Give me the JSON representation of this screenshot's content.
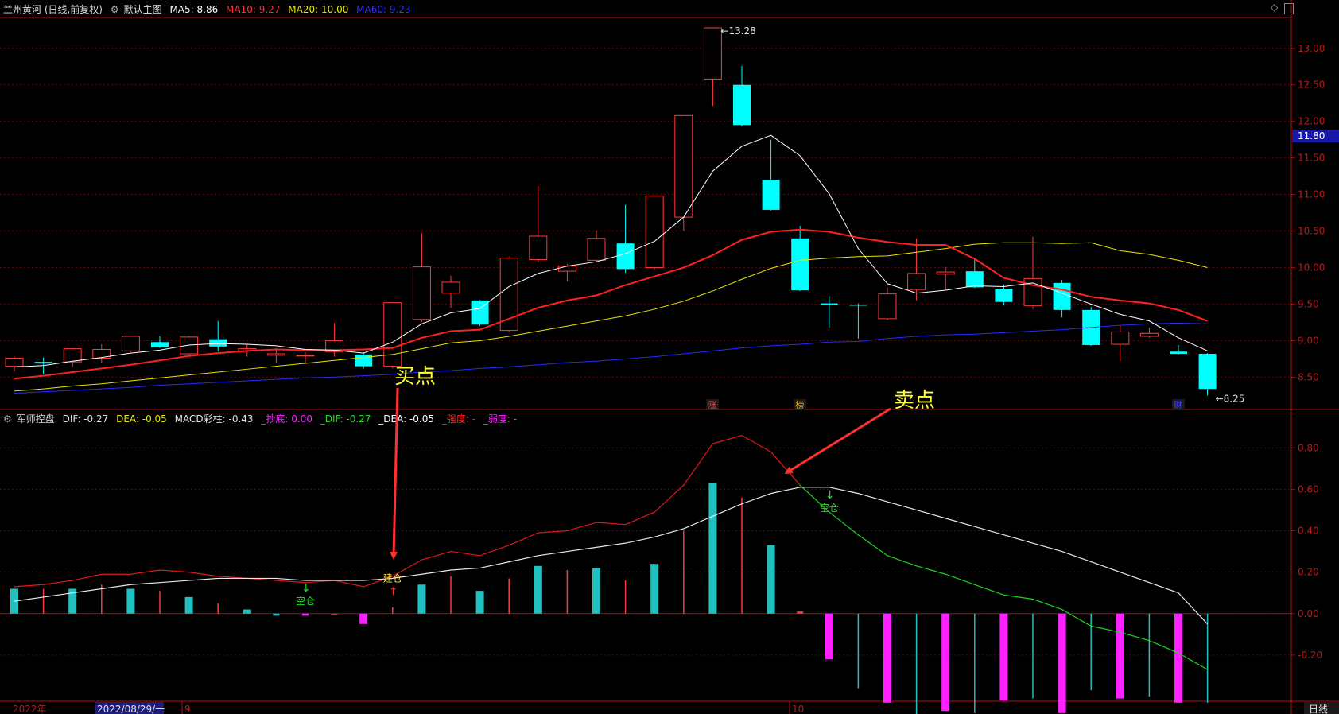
{
  "header": {
    "stock": "兰州黄河 (日线,前复权)",
    "main_label": "默认主图",
    "ma5": "MA5: 8.86",
    "ma10": "MA10: 9.27",
    "ma20": "MA20: 10.00",
    "ma60": "MA60: 9.23"
  },
  "sub_header": {
    "name": "军师控盘",
    "dif": "DIF: -0.27",
    "dea": "DEA: -0.05",
    "macd": "MACD彩柱: -0.43",
    "chaodi": "_抄底: 0.00",
    "sdif": "_DIF: -0.27",
    "sdea": "_DEA: -0.05",
    "qiangdu": "_强度: -",
    "ruodu": "_弱度: -"
  },
  "bottom": {
    "year": "2022年",
    "date": "2022/08/29/一",
    "m9": "9",
    "m10": "10",
    "period": "日线"
  },
  "annotations": {
    "buy": "买点",
    "sell": "卖点",
    "jiancang": "建仓",
    "kongcang": "空仓",
    "zhang": "涨",
    "bang": "榜",
    "cai": "财"
  },
  "price_marks": {
    "high": "13.28",
    "low": "8.25",
    "current": "11.80"
  },
  "colors": {
    "up": "#ff3b3b",
    "down": "#00ffff",
    "ma5": "#ffffff",
    "ma10": "#ff2020",
    "ma20": "#e6e600",
    "ma60": "#2a2aff",
    "grid": "#5a0a0a",
    "axis": "#b01010",
    "annotation": "#ffff33",
    "arrow": "#ff3030",
    "hist_pos": "#20c0c0",
    "hist_neg": "#ff20ff"
  },
  "chart_data": [
    {
      "type": "candlestick",
      "ylim": [
        8.2,
        13.4
      ],
      "yticks": [
        8.5,
        9.0,
        9.5,
        10.0,
        10.5,
        11.0,
        11.5,
        12.0,
        12.5,
        13.0
      ],
      "candles": [
        {
          "o": 8.65,
          "h": 8.78,
          "l": 8.58,
          "c": 8.76
        },
        {
          "o": 8.71,
          "h": 8.77,
          "l": 8.54,
          "c": 8.69
        },
        {
          "o": 8.71,
          "h": 8.9,
          "l": 8.64,
          "c": 8.89
        },
        {
          "o": 8.76,
          "h": 8.95,
          "l": 8.7,
          "c": 8.88
        },
        {
          "o": 8.86,
          "h": 9.06,
          "l": 8.84,
          "c": 9.06
        },
        {
          "o": 8.98,
          "h": 9.06,
          "l": 8.9,
          "c": 8.91
        },
        {
          "o": 8.82,
          "h": 9.06,
          "l": 8.81,
          "c": 9.05
        },
        {
          "o": 9.02,
          "h": 9.27,
          "l": 8.85,
          "c": 8.92
        },
        {
          "o": 8.86,
          "h": 8.95,
          "l": 8.78,
          "c": 8.89
        },
        {
          "o": 8.8,
          "h": 8.9,
          "l": 8.7,
          "c": 8.82
        },
        {
          "o": 8.8,
          "h": 8.84,
          "l": 8.7,
          "c": 8.8
        },
        {
          "o": 8.85,
          "h": 9.24,
          "l": 8.78,
          "c": 9.0
        },
        {
          "o": 8.81,
          "h": 8.84,
          "l": 8.62,
          "c": 8.65
        },
        {
          "o": 8.65,
          "h": 9.52,
          "l": 8.62,
          "c": 9.52
        },
        {
          "o": 9.29,
          "h": 10.47,
          "l": 9.26,
          "c": 10.01
        },
        {
          "o": 9.65,
          "h": 9.89,
          "l": 9.45,
          "c": 9.8
        },
        {
          "o": 9.55,
          "h": 9.56,
          "l": 9.2,
          "c": 9.22
        },
        {
          "o": 9.14,
          "h": 10.15,
          "l": 9.12,
          "c": 10.13
        },
        {
          "o": 10.11,
          "h": 11.12,
          "l": 10.07,
          "c": 10.43
        },
        {
          "o": 9.95,
          "h": 10.05,
          "l": 9.81,
          "c": 10.02
        },
        {
          "o": 10.1,
          "h": 10.51,
          "l": 10.07,
          "c": 10.4
        },
        {
          "o": 10.33,
          "h": 10.86,
          "l": 9.93,
          "c": 9.98
        },
        {
          "o": 10.0,
          "h": 10.99,
          "l": 9.98,
          "c": 10.98
        },
        {
          "o": 10.69,
          "h": 12.08,
          "l": 10.5,
          "c": 12.08
        },
        {
          "o": 12.58,
          "h": 13.28,
          "l": 12.21,
          "c": 13.28
        },
        {
          "o": 12.5,
          "h": 12.76,
          "l": 11.93,
          "c": 11.95
        },
        {
          "o": 11.2,
          "h": 11.75,
          "l": 10.78,
          "c": 10.79
        },
        {
          "o": 10.4,
          "h": 10.57,
          "l": 9.68,
          "c": 9.69
        },
        {
          "o": 9.51,
          "h": 9.61,
          "l": 9.18,
          "c": 9.49
        },
        {
          "o": 9.49,
          "h": 9.51,
          "l": 9.03,
          "c": 9.48
        },
        {
          "o": 9.3,
          "h": 9.73,
          "l": 9.28,
          "c": 9.64
        },
        {
          "o": 9.7,
          "h": 10.4,
          "l": 9.55,
          "c": 9.92
        },
        {
          "o": 9.91,
          "h": 10.01,
          "l": 9.7,
          "c": 9.94
        },
        {
          "o": 9.95,
          "h": 10.13,
          "l": 9.72,
          "c": 9.73
        },
        {
          "o": 9.71,
          "h": 9.77,
          "l": 9.48,
          "c": 9.53
        },
        {
          "o": 9.48,
          "h": 10.42,
          "l": 9.43,
          "c": 9.85
        },
        {
          "o": 9.79,
          "h": 9.83,
          "l": 9.32,
          "c": 9.42
        },
        {
          "o": 9.42,
          "h": 9.46,
          "l": 8.93,
          "c": 8.94
        },
        {
          "o": 8.95,
          "h": 9.21,
          "l": 8.72,
          "c": 9.12
        },
        {
          "o": 9.06,
          "h": 9.18,
          "l": 9.04,
          "c": 9.1
        },
        {
          "o": 8.85,
          "h": 8.94,
          "l": 8.81,
          "c": 8.82
        },
        {
          "o": 8.82,
          "h": 8.83,
          "l": 8.25,
          "c": 8.34
        }
      ],
      "ma5": [
        8.64,
        8.66,
        8.72,
        8.77,
        8.83,
        8.87,
        8.94,
        8.96,
        8.95,
        8.93,
        8.88,
        8.87,
        8.83,
        8.98,
        9.23,
        9.38,
        9.44,
        9.74,
        9.92,
        10.02,
        10.08,
        10.19,
        10.36,
        10.69,
        11.32,
        11.66,
        11.81,
        11.53,
        11.01,
        10.26,
        9.78,
        9.65,
        9.69,
        9.75,
        9.74,
        9.79,
        9.65,
        9.5,
        9.36,
        9.27,
        9.04,
        8.86
      ],
      "ma10": [
        8.48,
        8.52,
        8.57,
        8.62,
        8.67,
        8.73,
        8.79,
        8.83,
        8.86,
        8.88,
        8.87,
        8.87,
        8.88,
        8.9,
        9.04,
        9.13,
        9.15,
        9.3,
        9.45,
        9.55,
        9.62,
        9.76,
        9.88,
        10.0,
        10.17,
        10.38,
        10.49,
        10.52,
        10.49,
        10.41,
        10.35,
        10.31,
        10.31,
        10.12,
        9.86,
        9.76,
        9.7,
        9.6,
        9.55,
        9.51,
        9.42,
        9.27
      ],
      "ma20": [
        8.31,
        8.34,
        8.38,
        8.41,
        8.45,
        8.49,
        8.53,
        8.57,
        8.61,
        8.65,
        8.69,
        8.73,
        8.77,
        8.81,
        8.89,
        8.97,
        9.0,
        9.06,
        9.13,
        9.2,
        9.27,
        9.34,
        9.43,
        9.54,
        9.68,
        9.84,
        9.99,
        10.1,
        10.13,
        10.15,
        10.16,
        10.21,
        10.26,
        10.32,
        10.34,
        10.34,
        10.33,
        10.34,
        10.23,
        10.18,
        10.1,
        10.0
      ],
      "ma60": [
        8.28,
        8.3,
        8.32,
        8.34,
        8.36,
        8.39,
        8.41,
        8.43,
        8.45,
        8.47,
        8.49,
        8.5,
        8.52,
        8.54,
        8.57,
        8.59,
        8.62,
        8.64,
        8.67,
        8.7,
        8.72,
        8.75,
        8.78,
        8.82,
        8.86,
        8.9,
        8.93,
        8.95,
        8.98,
        8.99,
        9.03,
        9.06,
        9.08,
        9.09,
        9.11,
        9.13,
        9.15,
        9.18,
        9.21,
        9.23,
        9.24,
        9.23
      ]
    },
    {
      "type": "macd",
      "ylim": [
        -0.4,
        0.92
      ],
      "yticks": [
        -0.2,
        0.0,
        0.2,
        0.4,
        0.6,
        0.8
      ],
      "dif": [
        0.13,
        0.14,
        0.16,
        0.19,
        0.19,
        0.21,
        0.2,
        0.18,
        0.17,
        0.16,
        0.15,
        0.16,
        0.13,
        0.18,
        0.26,
        0.3,
        0.28,
        0.33,
        0.39,
        0.4,
        0.44,
        0.43,
        0.49,
        0.62,
        0.82,
        0.86,
        0.78,
        0.62,
        0.49,
        0.38,
        0.28,
        0.23,
        0.19,
        0.14,
        0.09,
        0.07,
        0.02,
        -0.06,
        -0.09,
        -0.13,
        -0.19,
        -0.27
      ],
      "dea": [
        0.06,
        0.08,
        0.1,
        0.12,
        0.14,
        0.15,
        0.16,
        0.17,
        0.17,
        0.17,
        0.16,
        0.16,
        0.16,
        0.17,
        0.19,
        0.21,
        0.22,
        0.25,
        0.28,
        0.3,
        0.32,
        0.34,
        0.37,
        0.41,
        0.47,
        0.53,
        0.58,
        0.61,
        0.61,
        0.58,
        0.54,
        0.5,
        0.46,
        0.42,
        0.38,
        0.34,
        0.3,
        0.25,
        0.2,
        0.15,
        0.1,
        -0.05
      ],
      "bars": [
        0.12,
        0.12,
        0.12,
        0.14,
        0.12,
        0.11,
        0.08,
        0.05,
        0.02,
        -0.01,
        -0.01,
        0.0,
        -0.05,
        0.03,
        0.14,
        0.18,
        0.11,
        0.17,
        0.23,
        0.21,
        0.22,
        0.16,
        0.24,
        0.4,
        0.63,
        0.56,
        0.33,
        0.01,
        -0.22,
        -0.36,
        -0.43,
        -0.52,
        -0.47,
        -0.48,
        -0.42,
        -0.41,
        -0.48,
        -0.37,
        -0.41,
        -0.4,
        -0.43,
        -0.43
      ],
      "signals": [
        {
          "index": 13,
          "label": "建仓",
          "kind": "buy"
        },
        {
          "index": 28,
          "label": "空仓",
          "kind": "sell"
        },
        {
          "index": 10,
          "label": "空仓",
          "kind": "sell"
        }
      ]
    }
  ]
}
